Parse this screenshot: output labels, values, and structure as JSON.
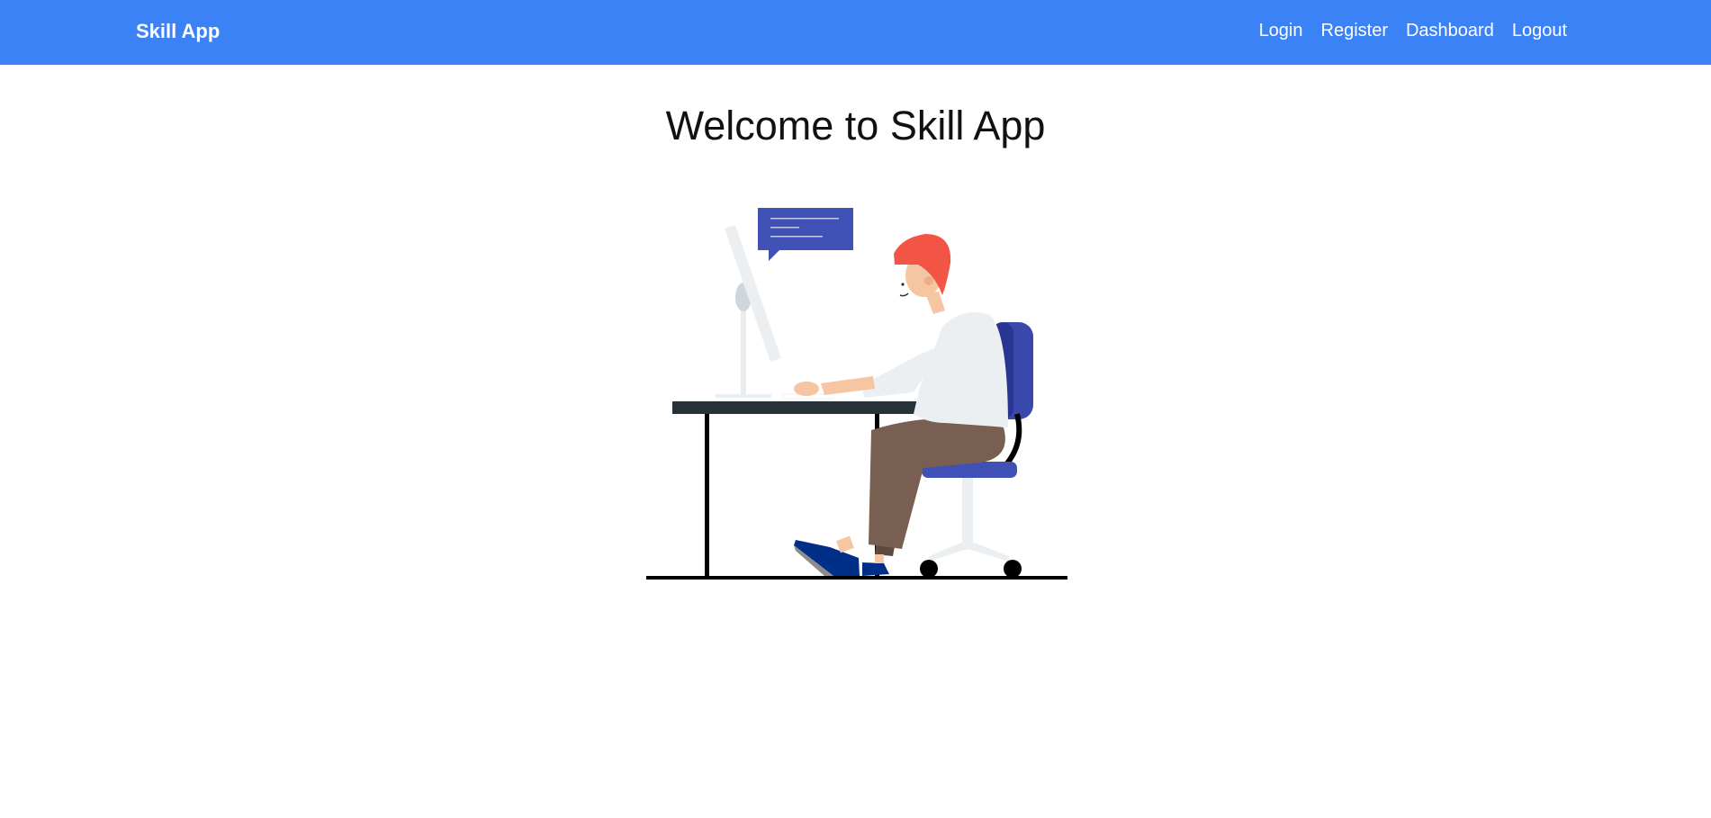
{
  "navbar": {
    "brand": "Skill App",
    "links": [
      {
        "label": "Login"
      },
      {
        "label": "Register"
      },
      {
        "label": "Dashboard"
      },
      {
        "label": "Logout"
      }
    ]
  },
  "main": {
    "title": "Welcome to Skill App",
    "illustration": "person-at-desk-illustration"
  },
  "colors": {
    "navbar": "#3b82f6",
    "nav_text": "#ffffff",
    "title_text": "#111111",
    "speech_bubble": "#3f51b5",
    "chair": "#3949ab",
    "hair": "#f25545",
    "pants": "#7a6152",
    "desk_top": "#263238"
  }
}
